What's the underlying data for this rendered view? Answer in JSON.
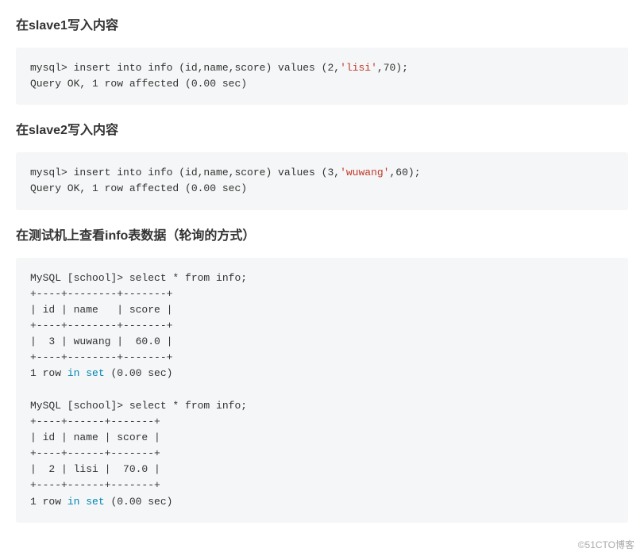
{
  "sections": {
    "s1": {
      "heading": "在slave1写入内容",
      "code": {
        "line1_a": "mysql> insert into info (id,name,score) values (2,",
        "line1_str": "'lisi'",
        "line1_b": ",70);",
        "line2": "Query OK, 1 row affected (0.00 sec)"
      }
    },
    "s2": {
      "heading": "在slave2写入内容",
      "code": {
        "line1_a": "mysql> insert into info (id,name,score) values (3,",
        "line1_str": "'wuwang'",
        "line1_b": ",60);",
        "line2": "Query OK, 1 row affected (0.00 sec)"
      }
    },
    "s3": {
      "heading": "在测试机上查看info表数据（轮询的方式）",
      "code": {
        "q1_line1": "MySQL [school]> select * from info;",
        "q1_sep1": "+----+--------+-------+",
        "q1_hdr": "| id | name   | score |",
        "q1_sep2": "+----+--------+-------+",
        "q1_row": "|  3 | wuwang |  60.0 |",
        "q1_sep3": "+----+--------+-------+",
        "q1_res_a": "1 row ",
        "q1_res_kw1": "in",
        "q1_res_sp": " ",
        "q1_res_kw2": "set",
        "q1_res_b": " (0.00 sec)",
        "blank": "",
        "q2_line1": "MySQL [school]> select * from info;",
        "q2_sep1": "+----+------+-------+",
        "q2_hdr": "| id | name | score |",
        "q2_sep2": "+----+------+-------+",
        "q2_row": "|  2 | lisi |  70.0 |",
        "q2_sep3": "+----+------+-------+",
        "q2_res_a": "1 row ",
        "q2_res_kw1": "in",
        "q2_res_sp": " ",
        "q2_res_kw2": "set",
        "q2_res_b": " (0.00 sec)"
      }
    }
  },
  "watermark": "©51CTO博客"
}
